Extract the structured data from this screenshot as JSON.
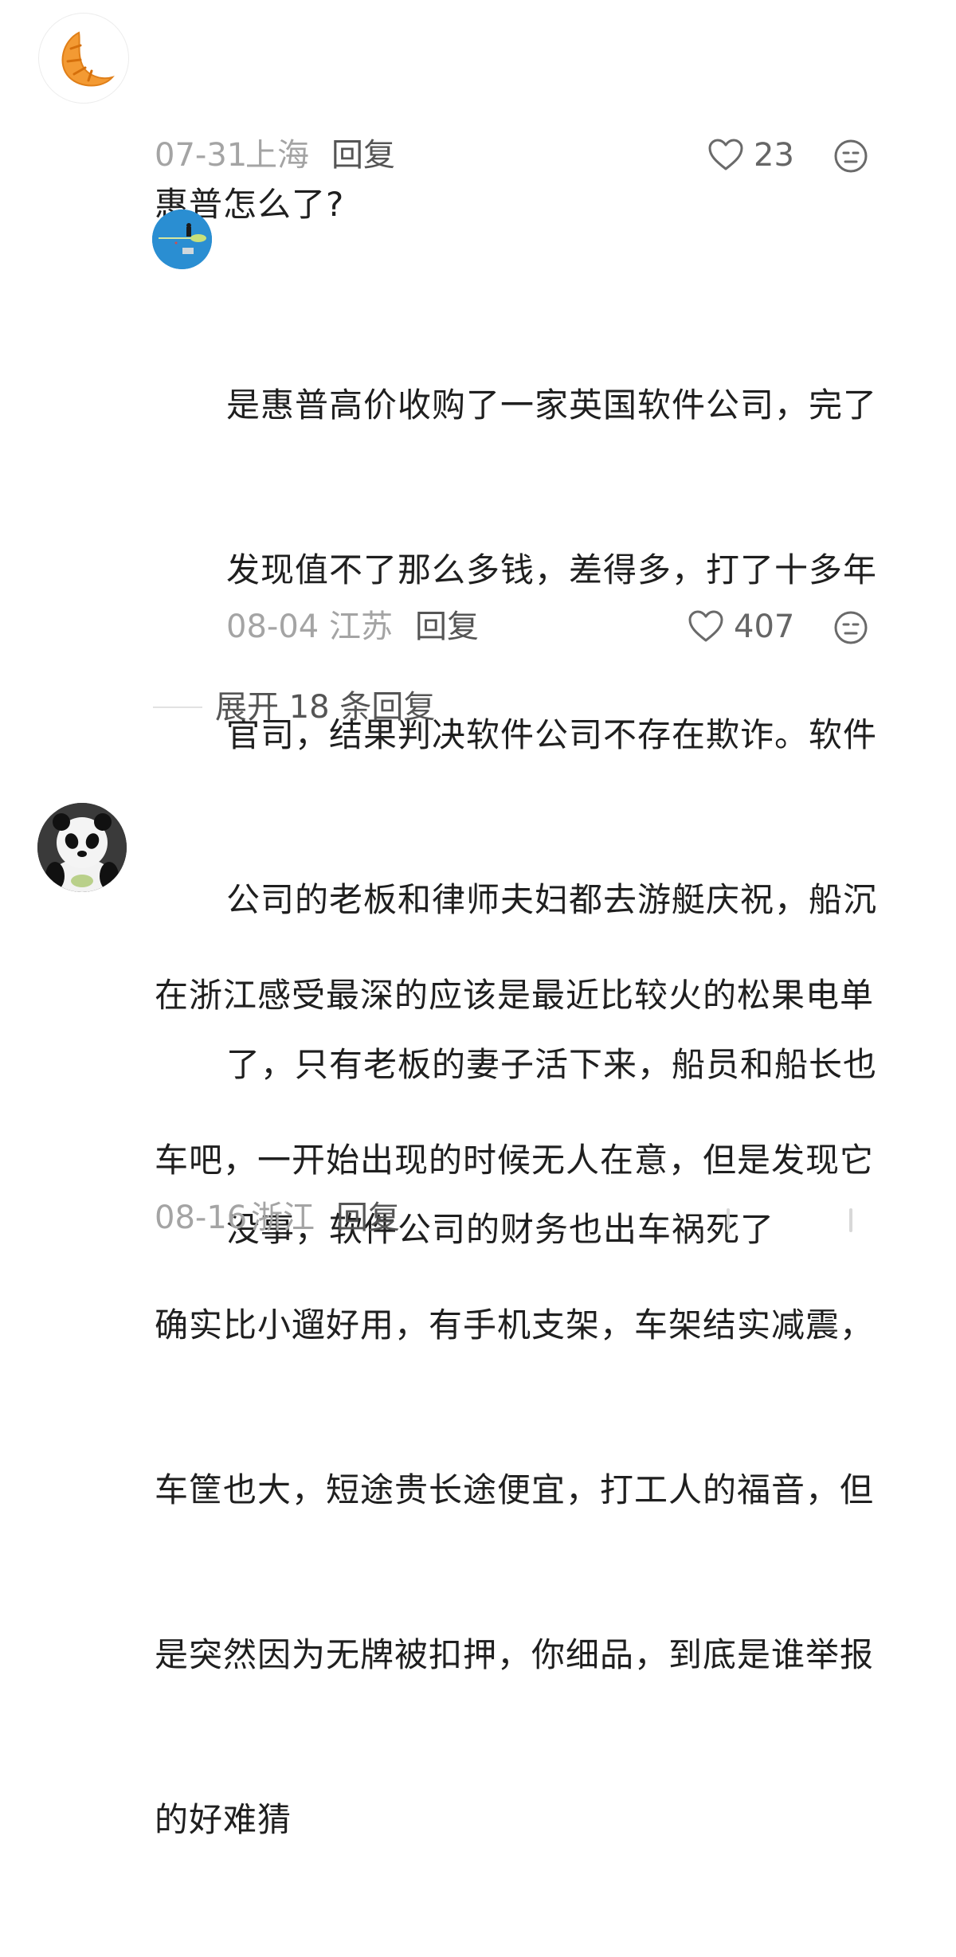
{
  "comments": [
    {
      "avatar_icon": "croissant-icon",
      "text_lines": [
        "惠普怎么了?"
      ],
      "date": "07-31",
      "location": "上海",
      "reply_label": "回复",
      "likes": "23",
      "reaction_icon": "meh-face-icon",
      "replies": [
        {
          "avatar_icon": "witch-on-broom-icon",
          "text_lines": [
            "是惠普高价收购了一家英国软件公司，完了",
            "发现值不了那么多钱，差得多，打了十多年",
            "官司，结果判决软件公司不存在欺诈。软件",
            "公司的老板和律师夫妇都去游艇庆祝，船沉",
            "了，只有老板的妻子活下来，船员和船长也",
            "没事，软件公司的财务也出车祸死了"
          ],
          "date": "08-04",
          "location": "江苏",
          "reply_label": "回复",
          "likes": "407",
          "reaction_icon": "meh-face-icon"
        }
      ],
      "expand_label": "展开 18 条回复"
    },
    {
      "avatar_icon": "panda-icon",
      "text_lines": [
        "在浙江感受最深的应该是最近比较火的松果电单",
        "车吧，一开始出现的时候无人在意，但是发现它",
        "确实比小遛好用，有手机支架，车架结实减震，",
        "车筐也大，短途贵长途便宜，打工人的福音，但",
        "是突然因为无牌被扣押，你细品，到底是谁举报",
        "的好难猜"
      ],
      "date": "08-16",
      "location": "浙江",
      "reply_label": "回复"
    }
  ],
  "colors": {
    "text": "#1f1f1f",
    "meta": "#a4a4a4",
    "action": "#555555",
    "croissant": "#f39a33",
    "background": "#ffffff"
  }
}
